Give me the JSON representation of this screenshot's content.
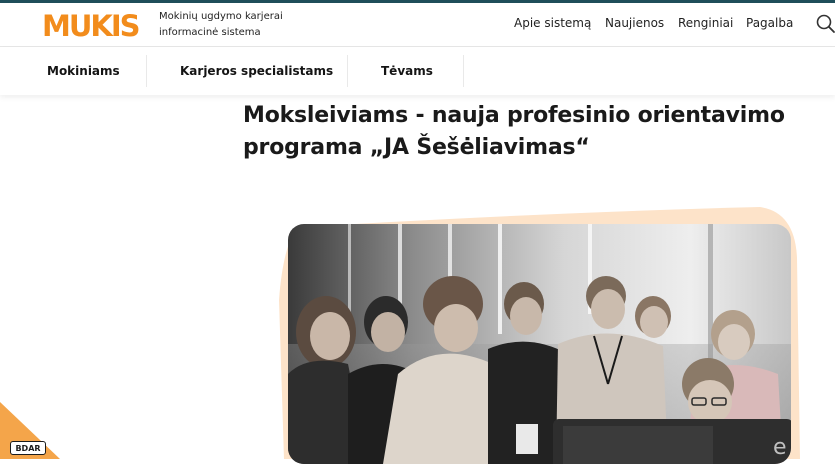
{
  "brand": {
    "logo_text": "MUKIS",
    "tagline_line1": "Mokinių ugdymo karjerai",
    "tagline_line2": "informacinė sistema",
    "accent_color": "#f28c1c"
  },
  "top_nav": {
    "items": [
      {
        "label": "Apie sistemą"
      },
      {
        "label": "Naujienos"
      },
      {
        "label": "Renginiai"
      },
      {
        "label": "Pagalba"
      }
    ],
    "search_icon": "search-icon"
  },
  "sub_nav": {
    "items": [
      {
        "label": "Mokiniams"
      },
      {
        "label": "Karjeros specialistams"
      },
      {
        "label": "Tėvams"
      }
    ]
  },
  "article": {
    "title_line1": "Moksleiviams - nauja profesinio orientavimo",
    "title_line2": "programa „JA Šešėliavimas“",
    "photo_text": "e"
  },
  "footer_widget": {
    "label": "BDAR",
    "color": "#f4a54a"
  }
}
